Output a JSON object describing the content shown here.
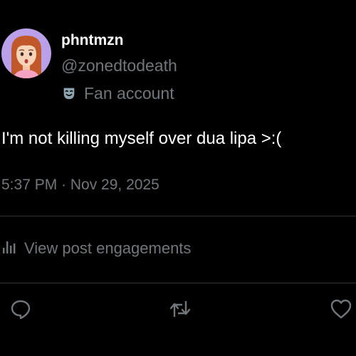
{
  "profile": {
    "display_name": "phntmzn",
    "handle": "@zonedtodeath",
    "badge_icon": "theater-mask-icon",
    "badge_label": "Fan account"
  },
  "post": {
    "text": "I'm not killing myself over dua lipa >:(",
    "timestamp": "5:37 PM · Nov 29, 2025"
  },
  "engagements": {
    "icon": "analytics-bars-icon",
    "label": "View post engagements"
  },
  "actions": [
    {
      "icon": "reply-icon"
    },
    {
      "icon": "repost-icon"
    },
    {
      "icon": "like-heart-icon"
    }
  ],
  "colors": {
    "background": "#000000",
    "primary_text": "#ffffff",
    "secondary_text": "#71767b",
    "divider": "#2f3336",
    "avatar_bg": "#b9a0e8"
  }
}
